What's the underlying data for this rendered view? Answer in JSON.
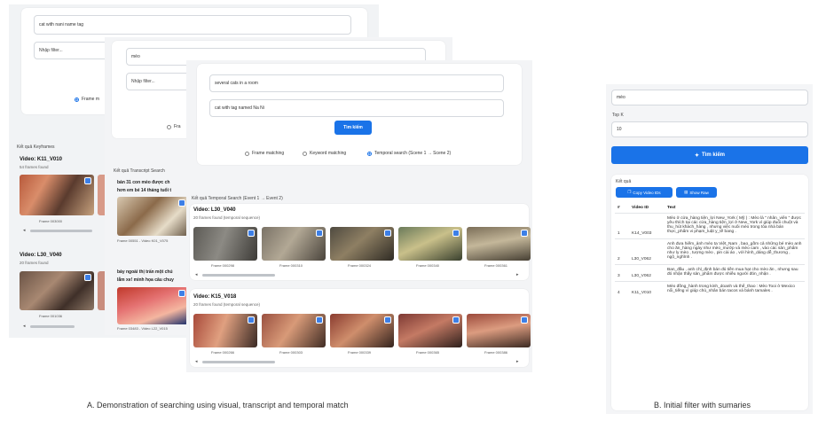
{
  "left": {
    "p1": {
      "query": "cat with nani name tag",
      "filter_placeholder": "Nhập filter...",
      "radio": "Frame m",
      "results_label": "Kết quả Keyframes",
      "videos": [
        {
          "name": "Video: K11_V010",
          "count": "54 frames found",
          "frames": [
            "Frame 003000"
          ]
        },
        {
          "name": "Video: L30_V040",
          "count": "20 frames found",
          "frames": [
            "Frame 001036"
          ]
        }
      ]
    },
    "p2": {
      "query": "mèo",
      "filter_placeholder": "Nhập filter...",
      "radio": "Fra",
      "results_label": "Kết quả Transcript Search",
      "transcripts": [
        {
          "text1": "bản 31 con mèo được ch",
          "text2": "hơn em bé 14 tháng tuổi t",
          "frame": "Frame 00551 - Video K01_V075"
        },
        {
          "text1": "bảy ngoài thị trấn một chú",
          "text2": "lắm xe! minh họa câu chuy",
          "frame": "Frame 03483 - Video L22_V015"
        }
      ]
    },
    "p3": {
      "query1": "several cats in a room",
      "query2": "cat with tag named Na Ni",
      "search_button": "Tìm kiếm",
      "radios": [
        "Frame matching",
        "Keyword matching",
        "Temporal search (Scene 1 → Scene 2)"
      ],
      "results_label": "Kết quả Temporal Search (Event 1 → Event 2)",
      "videos": [
        {
          "name": "Video: L30_V040",
          "count": "20 frames found (temporal sequence)",
          "frames": [
            "Frame 000298",
            "Frame 000310",
            "Frame 000324",
            "Frame 000340",
            "Frame 000361"
          ]
        },
        {
          "name": "Video: K15_V018",
          "count": "20 frames found (temporal sequence)",
          "frames": [
            "Frame 000266",
            "Frame 000303",
            "Frame 000339",
            "Frame 000365",
            "Frame 000386"
          ]
        }
      ]
    }
  },
  "right": {
    "filter_value": "mèo",
    "topk_label": "Top K",
    "topk_value": "10",
    "search_button": "Tìm kiếm",
    "results_label": "Kết quả",
    "copy_button": "Copy Video IDs",
    "raw_button": "Show Raw",
    "columns": [
      "#",
      "Video ID",
      "Text"
    ],
    "rows": [
      {
        "n": "1",
        "id": "K14_V003",
        "text": "Mèo ở cửa_hàng tiện_lợi New_York ( Mỹ ) : Mèo là \" nhân_viên \" được yêu thích tại các cửa_hàng tiện_lợi ở New_York vì giúp đuổi chuột và thu_hút khách_hàng , nhưng việc nuôi mèo trong tòa nhà bán thực_phẩm vi phạm_luật y_tế bang ."
      },
      {
        "n": "2",
        "id": "L30_V062",
        "text": "Anh đưa hiếm_ảnh mèo ta Việt_Nam , bao_gồm cả những bé mèo anh cho ăn_hàng ngày như mèo_mướp và mèo cam , vào các sản_phẩm như ly mèo , tượng mèo , pin cài áo , với hình_dáng dễ_thương , ngộ_nghĩnh ."
      },
      {
        "n": "3",
        "id": "L30_V062",
        "text": "Ban_đầu , anh chỉ_định bán đủ tiền mua hạt cho mèo ăn , nhưng sau đó nhận thấy sản_phẩm được nhiều người đón_nhận ."
      },
      {
        "n": "4",
        "id": "K11_V010",
        "text": "Mèo đồng_hành trong kinh_doanh và thể_thao : Mèo Tooi ở Mexico nổi_tiếng vì giúp chủ_nhân bán tacos và bánh tamales ."
      }
    ]
  },
  "captions": {
    "a": "A. Demonstration of searching using visual, transcript and temporal match",
    "b": "B. Initial filter with sumaries"
  }
}
